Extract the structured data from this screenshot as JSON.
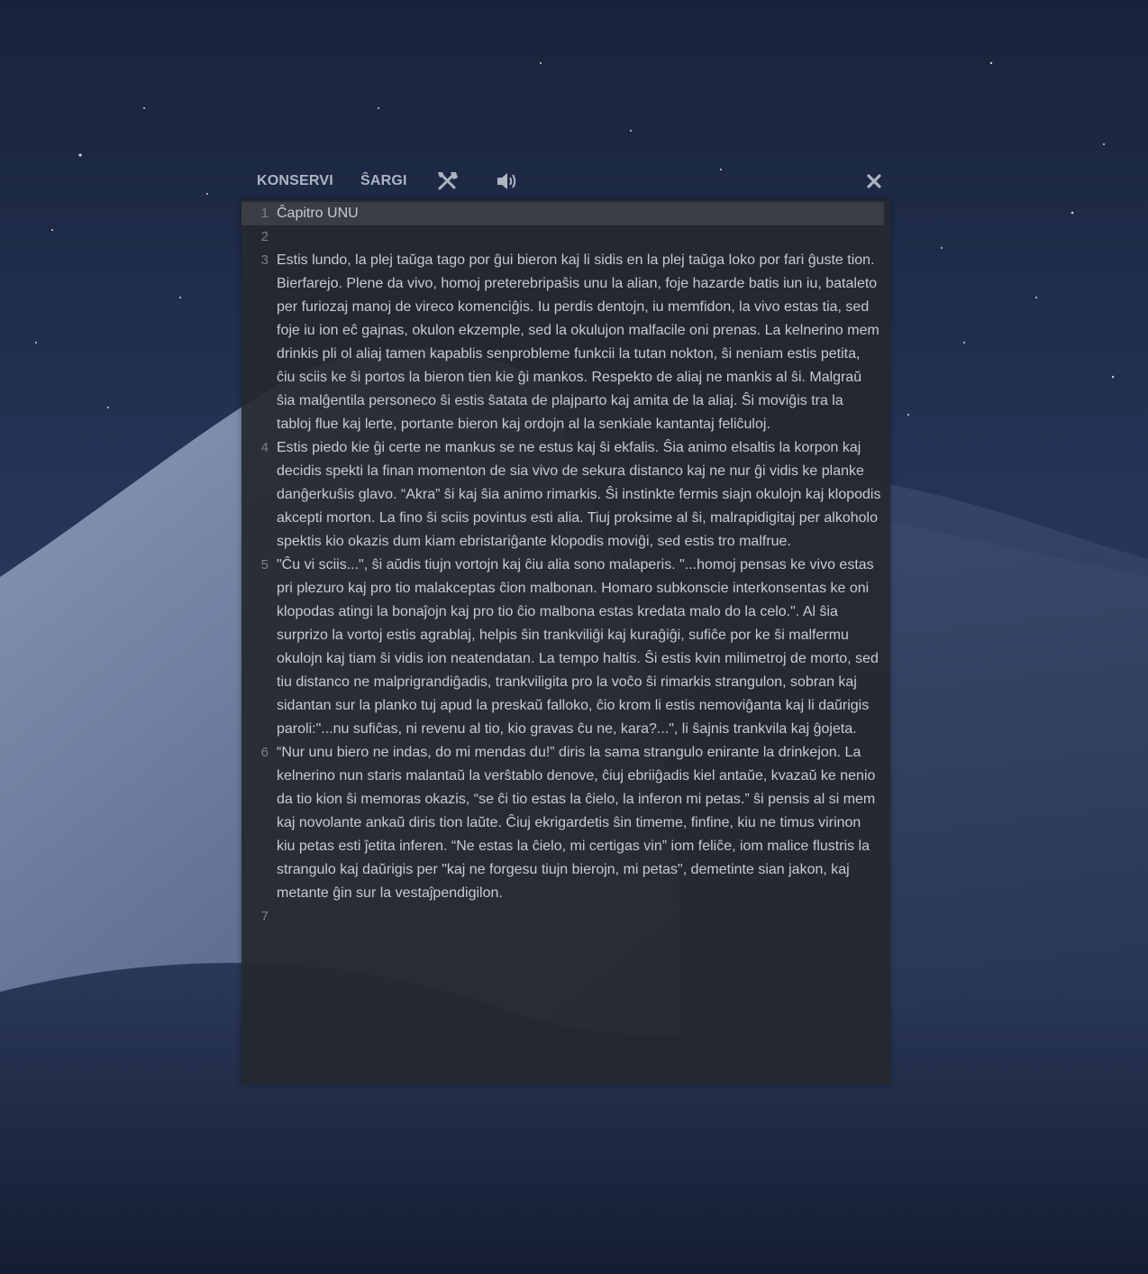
{
  "toolbar": {
    "save_label": "KONSERVI",
    "load_label": "ŜARGI",
    "settings_icon": "tools-icon",
    "sound_icon": "speaker-icon",
    "close_icon": "close-icon"
  },
  "editor": {
    "lines": [
      {
        "number": "1",
        "text": "Ĉapitro UNU"
      },
      {
        "number": "2",
        "text": ""
      },
      {
        "number": "3",
        "text": "Estis lundo, la plej taŭga tago por ĝui bieron kaj li sidis en la plej taŭga loko por fari ĝuste tion. Bierfarejo. Plene da vivo, homoj preterebripaŝis unu la alian, foje hazarde batis iun iu, bataleto per furiozaj manoj de vireco komenciĝis. Iu perdis dentojn, iu memfidon, la vivo estas tia, sed foje iu ion eĉ gajnas, okulon ekzemple, sed la okulujon malfacile oni prenas. La kelnerino mem drinkis pli ol aliaj tamen kapablis senprobleme funkcii la tutan nokton, ŝi neniam estis petita, ĉiu sciis ke ŝi portos la bieron tien kie ĝi mankos. Respekto de aliaj ne mankis al ŝi. Malgraŭ ŝia malĝentila personeco ŝi estis ŝatata de plajparto kaj amita de la aliaj. Ŝi moviĝis tra la tabloj flue kaj lerte, portante bieron kaj ordojn al la senkiale kantantaj feliĉuloj."
      },
      {
        "number": "4",
        "text": "Estis piedo kie ĝi certe ne mankus se ne estus kaj ŝi ekfalis. Ŝia animo elsaltis la korpon kaj decidis spekti la finan momenton de sia vivo de sekura distanco kaj ne nur ĝi vidis ke planke danĝerkuŝis glavo. “Akra” ŝi kaj ŝia animo rimarkis. Ŝi instinkte fermis siajn okulojn kaj klopodis akcepti morton. La fino ŝi sciis povintus esti alia. Tiuj proksime al ŝi, malrapidigitaj per alkoholo spektis kio okazis dum kiam ebristariĝante klopodis moviĝi, sed estis tro malfrue."
      },
      {
        "number": "5",
        "text": "\"Ĉu vi sciis...\", ŝi aŭdis tiujn vortojn kaj ĉiu alia sono malaperis. \"...homoj pensas ke vivo estas pri plezuro kaj pro tio malakceptas ĉion malbonan. Homaro subkonscie interkonsentas ke oni klopodas atingi la bonaĵojn kaj pro tio ĉio malbona estas kredata malo do la celo.\". Al ŝia surprizo la vortoj estis agrablaj, helpis ŝin trankviliĝi kaj kuraĝiĝi, sufiĉe por ke ŝi malfermu okulojn kaj tiam ŝi vidis ion neatendatan. La tempo haltis. Ŝi estis kvin milimetroj de morto, sed tiu distanco ne malprigrandiĝadis, trankviligita pro la voĉo ŝi rimarkis strangulon, sobran kaj sidantan sur la planko tuj apud la preskaŭ falloko, ĉio krom li estis nemoviĝanta kaj li daŭrigis paroli:\"...nu sufiĉas, ni revenu al tio, kio gravas ĉu ne, kara?...\", li ŝajnis trankvila kaj ĝojeta."
      },
      {
        "number": "6",
        "text": "“Nur unu biero ne indas, do mi mendas du!” diris la sama strangulo enirante la drinkejon. La kelnerino nun staris malantaŭ la verŝtablo denove, ĉiuj ebriiĝadis kiel antaŭe, kvazaŭ ke nenio da tio kion ŝi memoras okazis, “se ĉi tio estas la ĉielo, la inferon mi petas.” ŝi pensis al si mem kaj novolante ankaŭ diris tion laŭte. Ĉiuj ekrigardetis ŝin timeme, finfine, kiu ne timus virinon kiu petas esti ĵetita inferen. “Ne estas la ĉielo, mi certigas vin” iom feliĉe, iom malice flustris la strangulo kaj daŭrigis per \"kaj ne forgesu tiujn bierojn, mi petas\", demetinte sian jakon, kaj metante ĝin sur la vestaĵpendigilon."
      },
      {
        "number": "7",
        "text": ""
      }
    ]
  },
  "colors": {
    "editor_bg": "#25282f",
    "current_line_bg": "#3a3d44",
    "text": "#c6cbd3",
    "line_number": "#7a808a",
    "toolbar_text": "#aeb5c1"
  }
}
